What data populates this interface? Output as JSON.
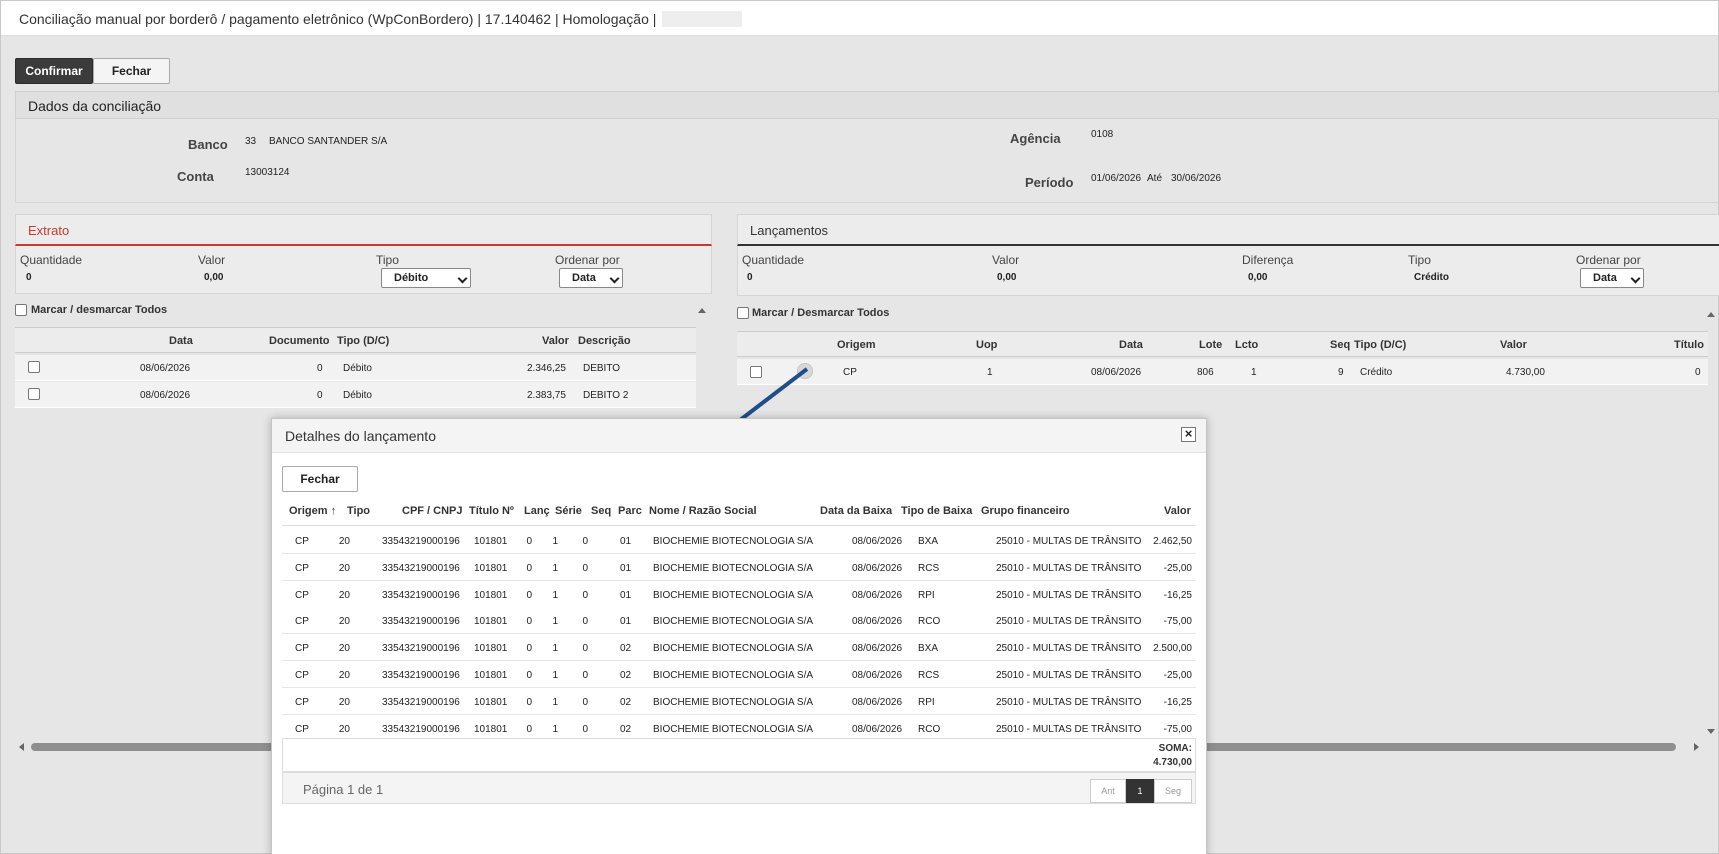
{
  "window": {
    "title": "Conciliação manual por borderô / pagamento eletrônico (WpConBordero) | 17.140462 | Homologação |"
  },
  "toolbar": {
    "confirm_label": "Confirmar",
    "close_label": "Fechar"
  },
  "conciliacao": {
    "header": "Dados da conciliação",
    "banco_label": "Banco",
    "banco_code": "33",
    "banco_name": "BANCO SANTANDER S/A",
    "conta_label": "Conta",
    "conta_value": "13003124",
    "agencia_label": "Agência",
    "agencia_value": "0108",
    "periodo_label": "Período",
    "periodo_start": "01/06/2026",
    "periodo_ate": "Até",
    "periodo_end": "30/06/2026"
  },
  "extrato": {
    "title": "Extrato",
    "quantidade_label": "Quantidade",
    "quantidade_value": "0",
    "valor_label": "Valor",
    "valor_value": "0,00",
    "tipo_label": "Tipo",
    "tipo_value": "Débito",
    "ordenar_label": "Ordenar por",
    "ordenar_value": "Data",
    "select_all": "Marcar / desmarcar Todos",
    "columns": {
      "data": "Data",
      "documento": "Documento",
      "tipo": "Tipo (D/C)",
      "valor": "Valor",
      "descricao": "Descrição"
    },
    "rows": [
      {
        "data": "08/06/2026",
        "documento": "0",
        "tipo": "Débito",
        "valor": "2.346,25",
        "descricao": "DEBITO"
      },
      {
        "data": "08/06/2026",
        "documento": "0",
        "tipo": "Débito",
        "valor": "2.383,75",
        "descricao": "DEBITO 2"
      }
    ]
  },
  "lancamentos": {
    "title": "Lançamentos",
    "quantidade_label": "Quantidade",
    "quantidade_value": "0",
    "valor_label": "Valor",
    "valor_value": "0,00",
    "diferenca_label": "Diferença",
    "diferenca_value": "0,00",
    "tipo_label": "Tipo",
    "tipo_value": "Crédito",
    "ordenar_label": "Ordenar por",
    "ordenar_value": "Data",
    "select_all": "Marcar / Desmarcar Todos",
    "columns": {
      "origem": "Origem",
      "uop": "Uop",
      "data": "Data",
      "lote": "Lote",
      "lcto": "Lcto",
      "seq": "Seq",
      "tipo": "Tipo (D/C)",
      "valor": "Valor",
      "titulo": "Título"
    },
    "rows": [
      {
        "origem": "CP",
        "uop": "1",
        "data": "08/06/2026",
        "lote": "806",
        "lcto": "1",
        "seq": "9",
        "tipo": "Crédito",
        "valor": "4.730,00",
        "titulo": "0"
      }
    ]
  },
  "modal": {
    "title": "Detalhes do lançamento",
    "close_label": "Fechar",
    "columns": {
      "origem": "Origem",
      "tipo": "Tipo",
      "cpf": "CPF / CNPJ",
      "titulo": "Título Nº",
      "lanc": "Lanç",
      "serie": "Série",
      "seq": "Seq",
      "parc": "Parc",
      "nome": "Nome / Razão Social",
      "data_baixa": "Data da Baixa",
      "tipo_baixa": "Tipo de Baixa",
      "grupo": "Grupo financeiro",
      "valor": "Valor"
    },
    "rows": [
      {
        "origem": "CP",
        "tipo": "20",
        "cpf": "33543219000196",
        "titulo": "101801",
        "lanc": "0",
        "serie": "1",
        "seq": "0",
        "parc": "01",
        "nome": "BIOCHEMIE BIOTECNOLOGIA S/A",
        "data_baixa": "08/06/2026",
        "tipo_baixa": "BXA",
        "grupo": "25010 - MULTAS DE TRÂNSITO",
        "valor": "2.462,50"
      },
      {
        "origem": "CP",
        "tipo": "20",
        "cpf": "33543219000196",
        "titulo": "101801",
        "lanc": "0",
        "serie": "1",
        "seq": "0",
        "parc": "01",
        "nome": "BIOCHEMIE BIOTECNOLOGIA S/A",
        "data_baixa": "08/06/2026",
        "tipo_baixa": "RCS",
        "grupo": "25010 - MULTAS DE TRÂNSITO",
        "valor": "-25,00"
      },
      {
        "origem": "CP",
        "tipo": "20",
        "cpf": "33543219000196",
        "titulo": "101801",
        "lanc": "0",
        "serie": "1",
        "seq": "0",
        "parc": "01",
        "nome": "BIOCHEMIE BIOTECNOLOGIA S/A",
        "data_baixa": "08/06/2026",
        "tipo_baixa": "RPI",
        "grupo": "25010 - MULTAS DE TRÂNSITO",
        "valor": "-16,25"
      },
      {
        "origem": "CP",
        "tipo": "20",
        "cpf": "33543219000196",
        "titulo": "101801",
        "lanc": "0",
        "serie": "1",
        "seq": "0",
        "parc": "01",
        "nome": "BIOCHEMIE BIOTECNOLOGIA S/A",
        "data_baixa": "08/06/2026",
        "tipo_baixa": "RCO",
        "grupo": "25010 - MULTAS DE TRÂNSITO",
        "valor": "-75,00"
      },
      {
        "origem": "CP",
        "tipo": "20",
        "cpf": "33543219000196",
        "titulo": "101801",
        "lanc": "0",
        "serie": "1",
        "seq": "0",
        "parc": "02",
        "nome": "BIOCHEMIE BIOTECNOLOGIA S/A",
        "data_baixa": "08/06/2026",
        "tipo_baixa": "BXA",
        "grupo": "25010 - MULTAS DE TRÂNSITO",
        "valor": "2.500,00"
      },
      {
        "origem": "CP",
        "tipo": "20",
        "cpf": "33543219000196",
        "titulo": "101801",
        "lanc": "0",
        "serie": "1",
        "seq": "0",
        "parc": "02",
        "nome": "BIOCHEMIE BIOTECNOLOGIA S/A",
        "data_baixa": "08/06/2026",
        "tipo_baixa": "RCS",
        "grupo": "25010 - MULTAS DE TRÂNSITO",
        "valor": "-25,00"
      },
      {
        "origem": "CP",
        "tipo": "20",
        "cpf": "33543219000196",
        "titulo": "101801",
        "lanc": "0",
        "serie": "1",
        "seq": "0",
        "parc": "02",
        "nome": "BIOCHEMIE BIOTECNOLOGIA S/A",
        "data_baixa": "08/06/2026",
        "tipo_baixa": "RPI",
        "grupo": "25010 - MULTAS DE TRÂNSITO",
        "valor": "-16,25"
      },
      {
        "origem": "CP",
        "tipo": "20",
        "cpf": "33543219000196",
        "titulo": "101801",
        "lanc": "0",
        "serie": "1",
        "seq": "0",
        "parc": "02",
        "nome": "BIOCHEMIE BIOTECNOLOGIA S/A",
        "data_baixa": "08/06/2026",
        "tipo_baixa": "RCO",
        "grupo": "25010 - MULTAS DE TRÂNSITO",
        "valor": "-75,00"
      }
    ],
    "soma_label": "SOMA:",
    "soma_value": "4.730,00",
    "pager_text": "Página 1 de 1",
    "pager_prev": "Ant",
    "pager_current": "1",
    "pager_next": "Seg"
  },
  "colors": {
    "accent_red": "#c83a2e",
    "arrow_blue": "#1f4e8c",
    "dark_button": "#3b3b3b"
  }
}
